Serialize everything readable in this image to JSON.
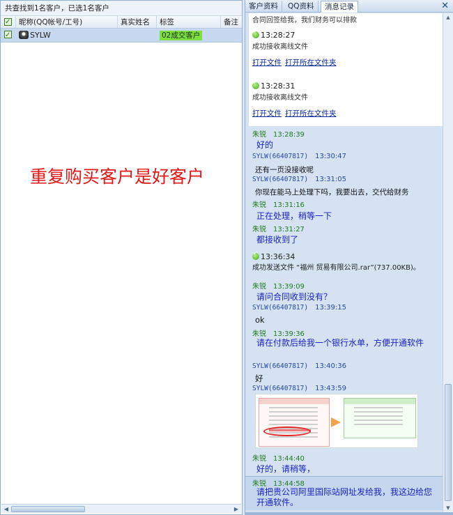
{
  "left": {
    "summary": "共查找到1名客户，已选1名客户",
    "columns": {
      "nickname": "昵称(QQ帐号/工号)",
      "realname": "真实姓名",
      "tag": "标签",
      "note": "备注"
    },
    "rows": [
      {
        "nickname": "SYLW",
        "realname": "",
        "tag": "02成交客户",
        "note": ""
      }
    ],
    "annotation": "重复购买客户是好客户"
  },
  "right": {
    "tabs": [
      "客户资料",
      "QQ资料",
      "消息记录"
    ],
    "active_tab": "消息记录",
    "close_glyph": "✕",
    "top_text": "合同回签给我，我们财务可以排款",
    "file_events": [
      {
        "time": "13:28:27",
        "text": "成功接收离线文件",
        "open": "打开文件",
        "open_folder": "打开所在文件夹"
      },
      {
        "time": "13:28:31",
        "text": "成功接收离线文件",
        "open": "打开文件",
        "open_folder": "打开所在文件夹"
      }
    ],
    "messages": [
      {
        "sender": "朱锐",
        "time": "13:28:39",
        "text": "好的"
      },
      {
        "sender": "SYLW(66407817)",
        "time": "13:30:47",
        "text": "还有一页没接收呢"
      },
      {
        "sender": "SYLW(66407817)",
        "time": "13:31:05",
        "text": "你现在能马上处理下吗，我要出去，交代给财务"
      },
      {
        "sender": "朱锐",
        "time": "13:31:16",
        "text": "正在处理，稍等一下"
      },
      {
        "sender": "朱锐",
        "time": "13:31:27",
        "text": "都接收到了"
      },
      {
        "sender": "朱锐",
        "time": "13:39:09",
        "text": "请问合同收到没有？"
      },
      {
        "sender": "SYLW(66407817)",
        "time": "13:39:15",
        "text": "ok"
      },
      {
        "sender": "朱锐",
        "time": "13:39:36",
        "text": "请在付款后给我一个银行水单，方便开通软件"
      },
      {
        "sender": "SYLW(66407817)",
        "time": "13:40:36",
        "text": "好"
      },
      {
        "sender": "SYLW(66407817)",
        "time": "13:43:59",
        "text": ""
      },
      {
        "sender": "朱锐",
        "time": "13:44:40",
        "text": "好的，请稍等，"
      },
      {
        "sender": "朱锐",
        "time": "13:44:58",
        "text": "请把贵公司阿里国际站网址发给我，我这边给您开通软件。"
      }
    ],
    "sent_file": {
      "time": "13:36:34",
      "text": "成功发送文件 “福州    贸易有限公司.rar”(737.00KB)。"
    },
    "colors": {
      "agent_name": "#1f7a1f",
      "customer_name": "#2448a8",
      "agent_text": "#1a22c8",
      "tag_badge": "#7ee03c",
      "annotation": "#e01818"
    }
  }
}
